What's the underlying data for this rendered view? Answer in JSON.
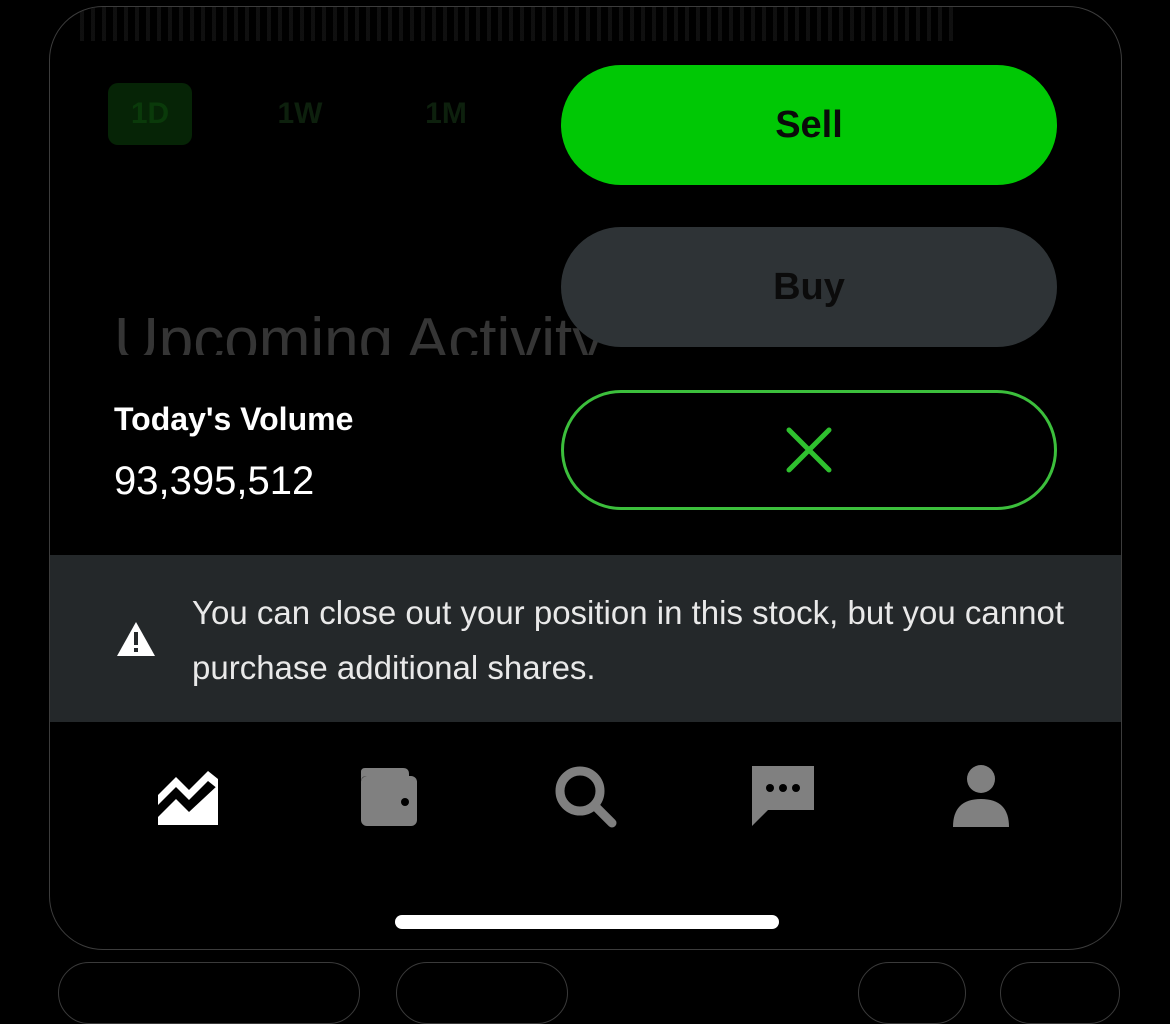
{
  "chart_ranges": [
    "1D",
    "1W",
    "1M"
  ],
  "active_range": "1D",
  "section_heading": "Upcoming Activity",
  "volume": {
    "label": "Today's Volume",
    "value": "93,395,512"
  },
  "actions": {
    "sell_label": "Sell",
    "buy_label": "Buy",
    "close_icon": "close-icon"
  },
  "banner": {
    "icon": "warning-icon",
    "text": "You can close out your position in this stock, but you cannot purchase additional shares."
  },
  "nav_icons": [
    "investing-chart-icon",
    "wallet-icon",
    "search-icon",
    "messages-icon",
    "account-icon"
  ],
  "colors": {
    "accent_green": "#00c805",
    "buy_gray": "#2e3336",
    "banner_bg": "#24282a",
    "nav_inactive": "#808080"
  }
}
